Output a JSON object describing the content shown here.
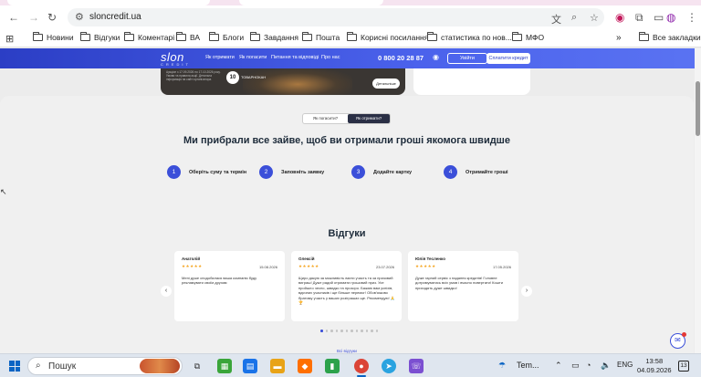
{
  "browser": {
    "url": "sloncredit.ua",
    "bookmarks": [
      "Новини",
      "Відгуки",
      "Коментарі",
      "ВА",
      "Блоги",
      "Завдання",
      "Пошта",
      "Корисні посилання",
      "статистика по нов...",
      "МФО"
    ],
    "all_bookmarks": "Все закладки"
  },
  "site": {
    "logo": "slon",
    "logo_sub": "CREDIT",
    "nav": [
      "Як отримати",
      "Як погасити",
      "Питання та відповіді",
      "Про нас"
    ],
    "phone": "0 800 20 28 87",
    "login": "Увійти",
    "pay": "Сплатити кредит"
  },
  "promo": {
    "text": "Аукціон з 17.09.2026 по 17.10.2026 року. Умови та правила акції. Детальна інформація на сайті організатора.",
    "badge": "10",
    "badge_text": "ТОВАРНОКАН",
    "more": "Детальніше"
  },
  "main": {
    "toggle": [
      "Як погасити?",
      "Як отримати?"
    ],
    "heading": "Ми прибрали все зайве, щоб ви отримали гроші якомога швидше",
    "steps": [
      {
        "num": "1",
        "label": "Оберіть суму та термін"
      },
      {
        "num": "2",
        "label": "Заповніть заявку"
      },
      {
        "num": "3",
        "label": "Додайте картку"
      },
      {
        "num": "4",
        "label": "Отримайте гроші"
      }
    ],
    "reviews_title": "Відгуки",
    "reviews": [
      {
        "name": "Анатолій",
        "stars": "★★★★★",
        "date": "15.08.2026",
        "text": "Мені дуже сподобалася ваша компанія буду рекламувати своїм друзям"
      },
      {
        "name": "Олексій",
        "stars": "★★★★★",
        "date": "23.07.2026",
        "text": "Щиро дякую за можливість взяти участь та за призовий виграш! Дуже радий отримати грошовий приз. Усе пройшло чесно, швидко та прозоро. Бажаю вам успіхів, вдячних учасників і ще більше перемог! Обов'язково братиму участь у ваших розіграшах ще. Рекомендую! 🙏🏆"
      },
      {
        "name": "Юлія Тесленко",
        "stars": "★★★★★",
        "date": "17.05.2026",
        "text": "Дуже гарний сервіс з надання кредитів! Головне дотримуватись всіх умов і вчасно повертати! Кошти приходять дуже швидко!"
      }
    ],
    "all_reviews": "Всі відгуки"
  },
  "taskbar": {
    "search": "Пошук",
    "weather": "Tem...",
    "lang": "ENG",
    "time": "13:58",
    "date": "04.09.2026",
    "notifications": "13"
  }
}
